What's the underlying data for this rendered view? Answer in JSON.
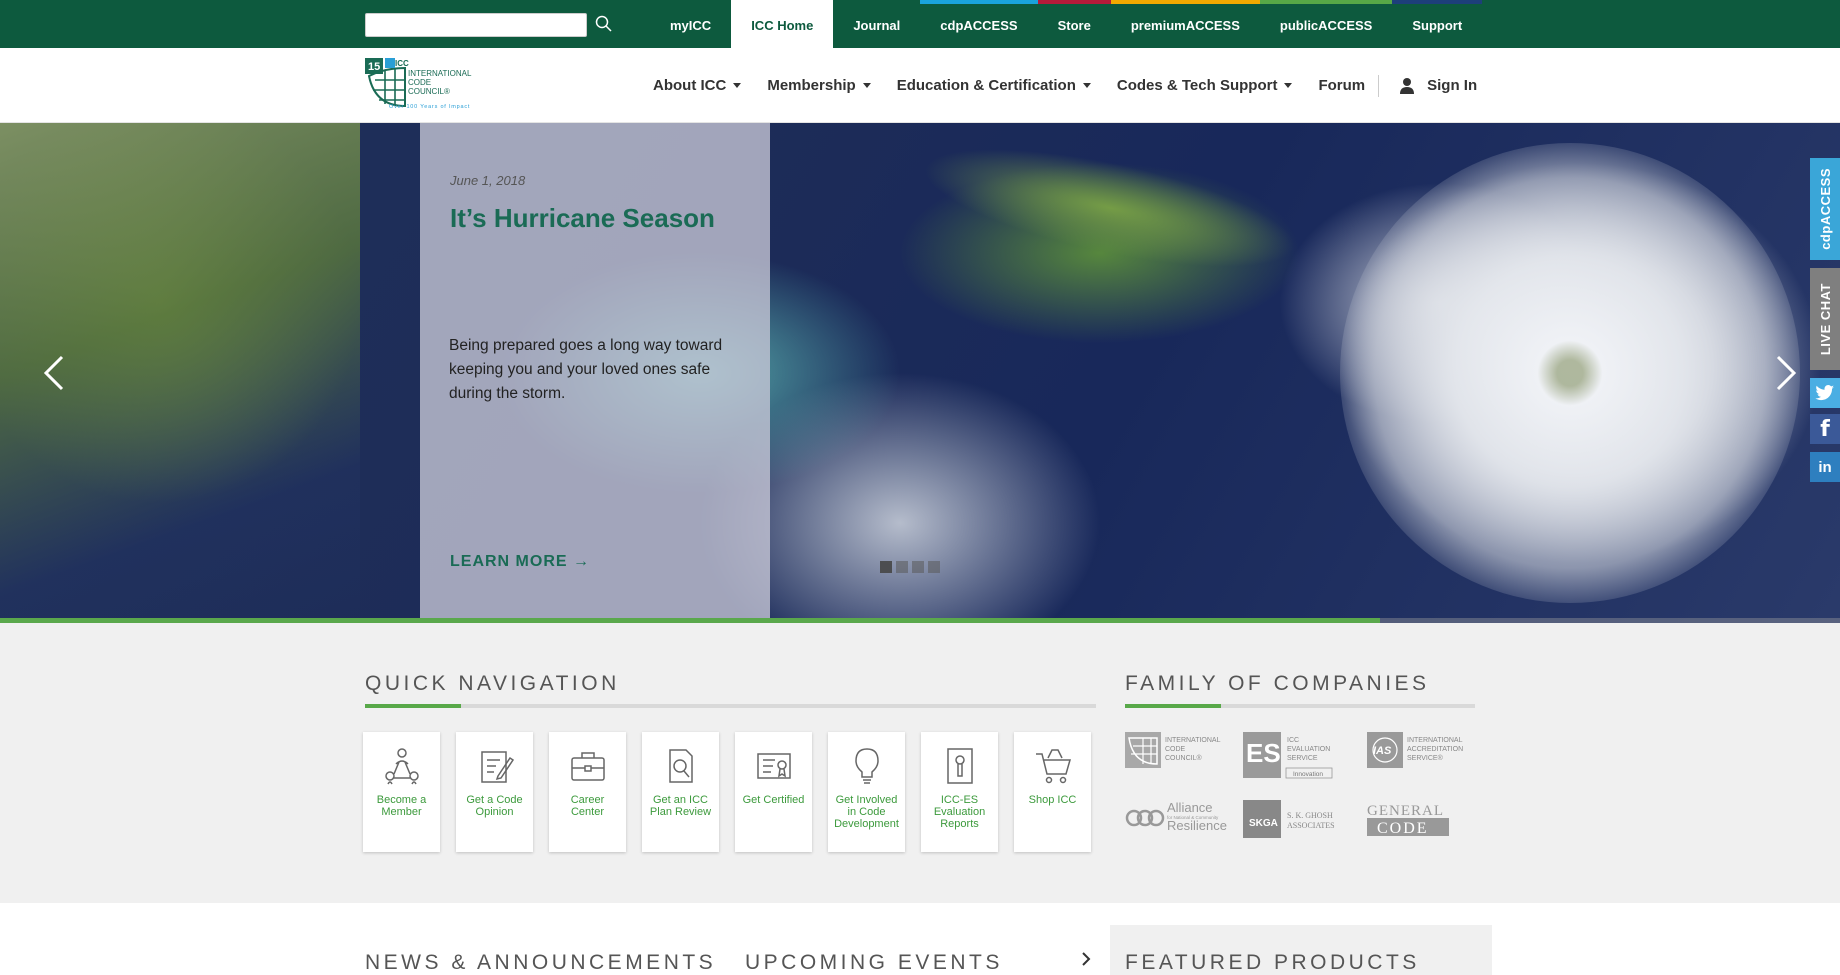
{
  "top_bar": {
    "search": {
      "placeholder": "",
      "value": ""
    },
    "nav": [
      {
        "label": "myICC",
        "active": false,
        "accent": ""
      },
      {
        "label": "ICC Home",
        "active": true,
        "accent": ""
      },
      {
        "label": "Journal",
        "active": false,
        "accent": ""
      },
      {
        "label": "cdpACCESS",
        "active": false,
        "accent": "#1aa3dc"
      },
      {
        "label": "Store",
        "active": false,
        "accent": "#b51a3a"
      },
      {
        "label": "premiumACCESS",
        "active": false,
        "accent": "#f2a900"
      },
      {
        "label": "publicACCESS",
        "active": false,
        "accent": "#57a847"
      },
      {
        "label": "Support",
        "active": false,
        "accent": "#1d3f7a"
      }
    ]
  },
  "logo": {
    "line1": "INTERNATIONAL",
    "line2": "CODE",
    "line3": "COUNCIL®",
    "tagline": "Over 100 Years of Impact",
    "badge": "15"
  },
  "main_nav": {
    "items": [
      {
        "label": "About ICC",
        "dropdown": true
      },
      {
        "label": "Membership",
        "dropdown": true
      },
      {
        "label": "Education & Certification",
        "dropdown": true
      },
      {
        "label": "Codes & Tech Support",
        "dropdown": true
      },
      {
        "label": "Forum",
        "dropdown": false
      }
    ],
    "signin": "Sign In"
  },
  "hero": {
    "date": "June 1, 2018",
    "title": "It’s Hurricane Season",
    "text": "Being prepared goes a long way toward keeping you and your loved ones safe during the storm.",
    "link": "LEARN MORE →",
    "slides": 4,
    "active_slide": 0,
    "progress": 0.75
  },
  "side_tabs": {
    "cdp": "cdpACCESS",
    "chat": "LIVE CHAT",
    "twitter": "twitter-icon",
    "facebook": "f",
    "linkedin": "in"
  },
  "quick_nav": {
    "title": "QUICK NAVIGATION",
    "cards": [
      {
        "label": "Become a Member",
        "icon": "network-people-icon"
      },
      {
        "label": "Get a Code Opinion",
        "icon": "edit-document-icon"
      },
      {
        "label": "Career Center",
        "icon": "briefcase-icon"
      },
      {
        "label": "Get an ICC Plan Review",
        "icon": "document-search-icon"
      },
      {
        "label": "Get Certified",
        "icon": "certificate-icon"
      },
      {
        "label": "Get Involved in Code Development",
        "icon": "lightbulb-icon"
      },
      {
        "label": "ICC-ES Evaluation Reports",
        "icon": "report-icon"
      },
      {
        "label": "Shop ICC",
        "icon": "shopping-cart-icon"
      }
    ]
  },
  "companies": {
    "title": "FAMILY OF COMPANIES",
    "logos": [
      {
        "name": "ICC",
        "lines": [
          "INTERNATIONAL",
          "CODE",
          "COUNCIL®"
        ]
      },
      {
        "name": "ES",
        "lines": [
          "ICC",
          "EVALUATION",
          "SERVICE"
        ],
        "sub": "Innovation"
      },
      {
        "name": "IAS",
        "lines": [
          "INTERNATIONAL",
          "ACCREDITATION",
          "SERVICE®"
        ]
      },
      {
        "name": "Alliance",
        "lines": [
          "Alliance",
          "for National & Community",
          "Resilience"
        ]
      },
      {
        "name": "SKGA",
        "lines": [
          "S. K. GHOSH",
          "ASSOCIATES"
        ]
      },
      {
        "name": "General Code",
        "lines": [
          "GENERAL",
          "CODE"
        ]
      }
    ]
  },
  "bottom": {
    "news_title": "NEWS & ANNOUNCEMENTS",
    "events_title": "UPCOMING EVENTS",
    "featured_title": "FEATURED PRODUCTS"
  }
}
